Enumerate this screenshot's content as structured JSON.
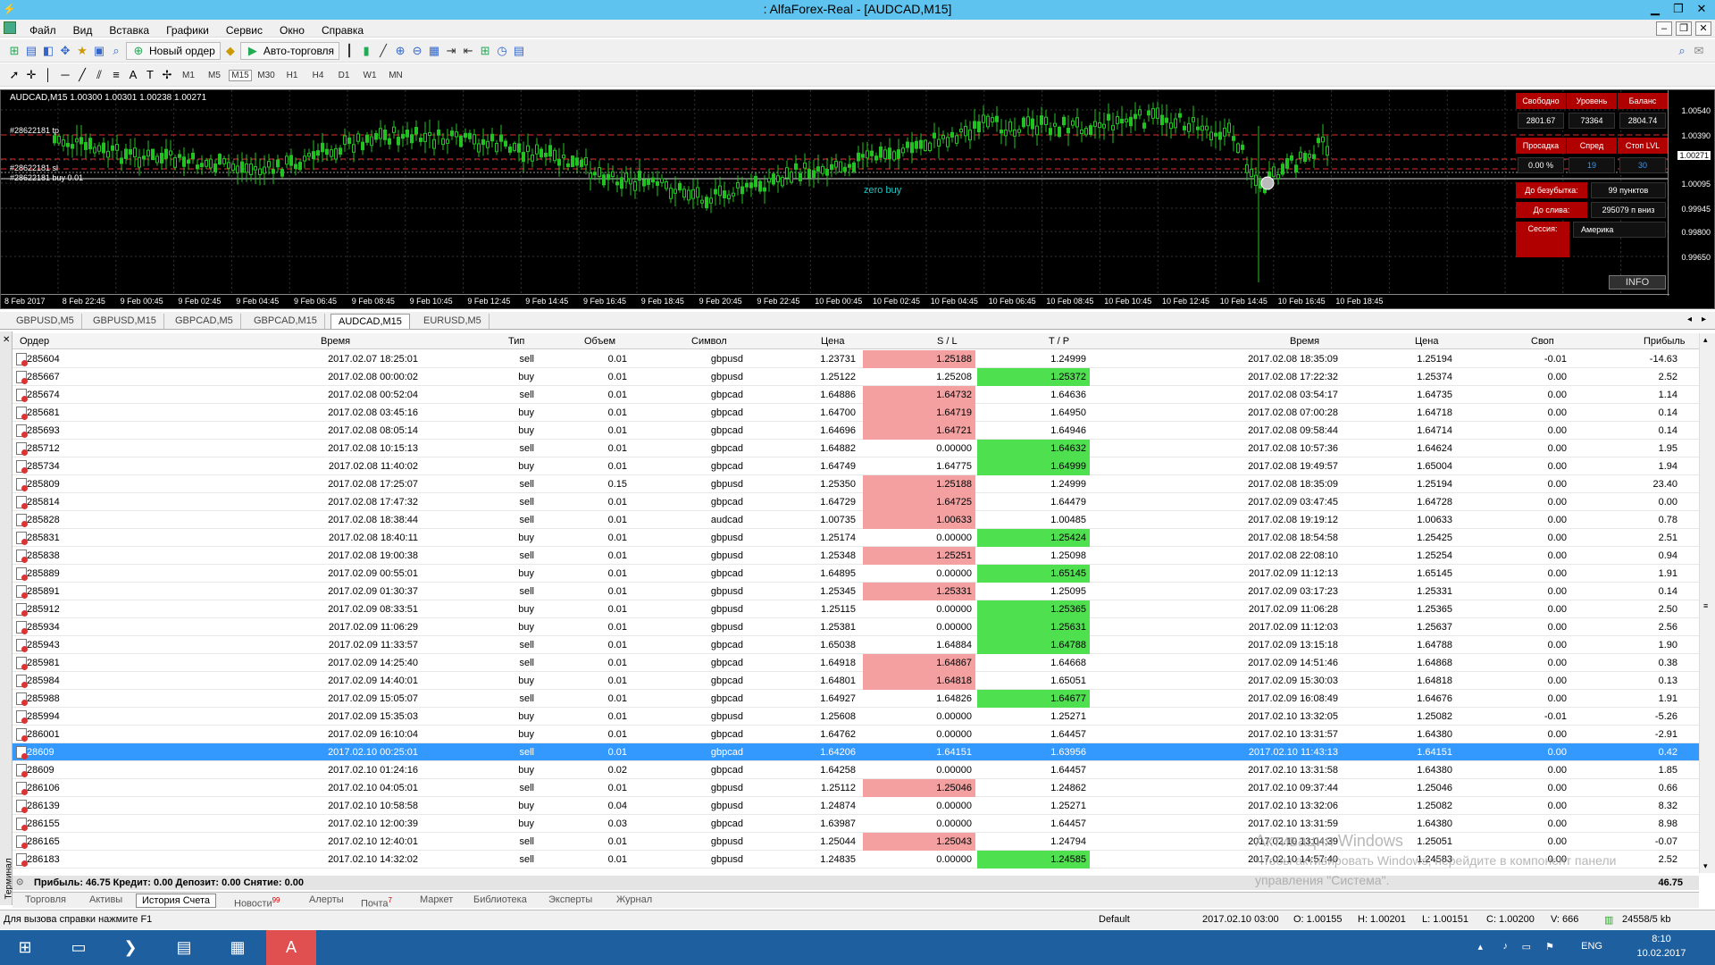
{
  "window": {
    "title": "AlfaForex-Real - [AUDCAD,M15]",
    "title_visible": ": AlfaForex-Real - [AUDCAD,M15]"
  },
  "menu": [
    "Файл",
    "Вид",
    "Вставка",
    "Графики",
    "Сервис",
    "Окно",
    "Справка"
  ],
  "toolbar": {
    "new_order": "Новый ордер",
    "auto_trading": "Авто-торговля"
  },
  "timeframes": [
    "M1",
    "M5",
    "M15",
    "M30",
    "H1",
    "H4",
    "D1",
    "W1",
    "MN"
  ],
  "active_timeframe": "M15",
  "chart": {
    "header": "AUDCAD,M15  1.00300 1.00301 1.00238 1.00271",
    "order_labels": [
      "#28622181 tp",
      "#28622181 sl",
      "#28622181 buy 0.01"
    ],
    "zero_buy_label": "zero buy",
    "price_ticks": [
      "1.00540",
      "1.00390",
      "1.00271",
      "1.00095",
      "0.99945",
      "0.99800",
      "0.99650"
    ],
    "current_price": "1.00271",
    "time_ticks": [
      "8 Feb 2017",
      "8 Feb 22:45",
      "9 Feb 00:45",
      "9 Feb 02:45",
      "9 Feb 04:45",
      "9 Feb 06:45",
      "9 Feb 08:45",
      "9 Feb 10:45",
      "9 Feb 12:45",
      "9 Feb 14:45",
      "9 Feb 16:45",
      "9 Feb 18:45",
      "9 Feb 20:45",
      "9 Feb 22:45",
      "10 Feb 00:45",
      "10 Feb 02:45",
      "10 Feb 04:45",
      "10 Feb 06:45",
      "10 Feb 08:45",
      "10 Feb 10:45",
      "10 Feb 12:45",
      "10 Feb 14:45",
      "10 Feb 16:45",
      "10 Feb 18:45"
    ],
    "panel": {
      "free_label": "Свободно",
      "level_label": "Уровень",
      "balance_label": "Баланс",
      "free": "2801.67",
      "level": "73364",
      "balance": "2804.74",
      "drawdown_label": "Просадка",
      "spread_label": "Спред",
      "stop_label": "Стоп LVL",
      "drawdown": "0.00 %",
      "spread": "19",
      "stop": "30",
      "breakeven_label": "До безубытка:",
      "breakeven": "99 пунктов",
      "margin_label": "До слива:",
      "margin": "295079 п вниз",
      "session_label": "Сессия:",
      "session": "Америка"
    },
    "info_button": "INFO"
  },
  "chart_tabs": [
    "GBPUSD,M5",
    "GBPUSD,M15",
    "GBPCAD,M5",
    "GBPCAD,M15",
    "AUDCAD,M15",
    "EURUSD,M5"
  ],
  "active_chart_tab": "AUDCAD,M15",
  "table": {
    "headers": [
      "Ордер",
      "Время",
      "Тип",
      "Объем",
      "Символ",
      "Цена",
      "S / L",
      "T / P",
      "Время",
      "Цена",
      "Своп",
      "Прибыль"
    ],
    "rows": [
      {
        "order": "285604",
        "t1": "2017.02.07 18:25:01",
        "type": "sell",
        "vol": "0.01",
        "sym": "gbpusd",
        "p1": "1.23731",
        "sl": "1.25188",
        "tp": "1.24999",
        "t2": "2017.02.08 18:35:09",
        "p2": "1.25194",
        "swap": "-0.01",
        "profit": "-14.63",
        "slh": true,
        "tph": false
      },
      {
        "order": "285667",
        "t1": "2017.02.08 00:00:02",
        "type": "buy",
        "vol": "0.01",
        "sym": "gbpusd",
        "p1": "1.25122",
        "sl": "1.25208",
        "tp": "1.25372",
        "t2": "2017.02.08 17:22:32",
        "p2": "1.25374",
        "swap": "0.00",
        "profit": "2.52",
        "slh": false,
        "tph": true
      },
      {
        "order": "285674",
        "t1": "2017.02.08 00:52:04",
        "type": "sell",
        "vol": "0.01",
        "sym": "gbpcad",
        "p1": "1.64886",
        "sl": "1.64732",
        "tp": "1.64636",
        "t2": "2017.02.08 03:54:17",
        "p2": "1.64735",
        "swap": "0.00",
        "profit": "1.14",
        "slh": true,
        "tph": false
      },
      {
        "order": "285681",
        "t1": "2017.02.08 03:45:16",
        "type": "buy",
        "vol": "0.01",
        "sym": "gbpcad",
        "p1": "1.64700",
        "sl": "1.64719",
        "tp": "1.64950",
        "t2": "2017.02.08 07:00:28",
        "p2": "1.64718",
        "swap": "0.00",
        "profit": "0.14",
        "slh": true,
        "tph": false
      },
      {
        "order": "285693",
        "t1": "2017.02.08 08:05:14",
        "type": "buy",
        "vol": "0.01",
        "sym": "gbpcad",
        "p1": "1.64696",
        "sl": "1.64721",
        "tp": "1.64946",
        "t2": "2017.02.08 09:58:44",
        "p2": "1.64714",
        "swap": "0.00",
        "profit": "0.14",
        "slh": true,
        "tph": false
      },
      {
        "order": "285712",
        "t1": "2017.02.08 10:15:13",
        "type": "sell",
        "vol": "0.01",
        "sym": "gbpcad",
        "p1": "1.64882",
        "sl": "0.00000",
        "tp": "1.64632",
        "t2": "2017.02.08 10:57:36",
        "p2": "1.64624",
        "swap": "0.00",
        "profit": "1.95",
        "slh": false,
        "tph": true
      },
      {
        "order": "285734",
        "t1": "2017.02.08 11:40:02",
        "type": "buy",
        "vol": "0.01",
        "sym": "gbpcad",
        "p1": "1.64749",
        "sl": "1.64775",
        "tp": "1.64999",
        "t2": "2017.02.08 19:49:57",
        "p2": "1.65004",
        "swap": "0.00",
        "profit": "1.94",
        "slh": false,
        "tph": true
      },
      {
        "order": "285809",
        "t1": "2017.02.08 17:25:07",
        "type": "sell",
        "vol": "0.15",
        "sym": "gbpusd",
        "p1": "1.25350",
        "sl": "1.25188",
        "tp": "1.24999",
        "t2": "2017.02.08 18:35:09",
        "p2": "1.25194",
        "swap": "0.00",
        "profit": "23.40",
        "slh": true,
        "tph": false
      },
      {
        "order": "285814",
        "t1": "2017.02.08 17:47:32",
        "type": "sell",
        "vol": "0.01",
        "sym": "gbpcad",
        "p1": "1.64729",
        "sl": "1.64725",
        "tp": "1.64479",
        "t2": "2017.02.09 03:47:45",
        "p2": "1.64728",
        "swap": "0.00",
        "profit": "0.00",
        "slh": true,
        "tph": false
      },
      {
        "order": "285828",
        "t1": "2017.02.08 18:38:44",
        "type": "sell",
        "vol": "0.01",
        "sym": "audcad",
        "p1": "1.00735",
        "sl": "1.00633",
        "tp": "1.00485",
        "t2": "2017.02.08 19:19:12",
        "p2": "1.00633",
        "swap": "0.00",
        "profit": "0.78",
        "slh": true,
        "tph": false
      },
      {
        "order": "285831",
        "t1": "2017.02.08 18:40:11",
        "type": "buy",
        "vol": "0.01",
        "sym": "gbpusd",
        "p1": "1.25174",
        "sl": "0.00000",
        "tp": "1.25424",
        "t2": "2017.02.08 18:54:58",
        "p2": "1.25425",
        "swap": "0.00",
        "profit": "2.51",
        "slh": false,
        "tph": true
      },
      {
        "order": "285838",
        "t1": "2017.02.08 19:00:38",
        "type": "sell",
        "vol": "0.01",
        "sym": "gbpusd",
        "p1": "1.25348",
        "sl": "1.25251",
        "tp": "1.25098",
        "t2": "2017.02.08 22:08:10",
        "p2": "1.25254",
        "swap": "0.00",
        "profit": "0.94",
        "slh": true,
        "tph": false
      },
      {
        "order": "285889",
        "t1": "2017.02.09 00:55:01",
        "type": "buy",
        "vol": "0.01",
        "sym": "gbpcad",
        "p1": "1.64895",
        "sl": "0.00000",
        "tp": "1.65145",
        "t2": "2017.02.09 11:12:13",
        "p2": "1.65145",
        "swap": "0.00",
        "profit": "1.91",
        "slh": false,
        "tph": true
      },
      {
        "order": "285891",
        "t1": "2017.02.09 01:30:37",
        "type": "sell",
        "vol": "0.01",
        "sym": "gbpusd",
        "p1": "1.25345",
        "sl": "1.25331",
        "tp": "1.25095",
        "t2": "2017.02.09 03:17:23",
        "p2": "1.25331",
        "swap": "0.00",
        "profit": "0.14",
        "slh": true,
        "tph": false
      },
      {
        "order": "285912",
        "t1": "2017.02.09 08:33:51",
        "type": "buy",
        "vol": "0.01",
        "sym": "gbpusd",
        "p1": "1.25115",
        "sl": "0.00000",
        "tp": "1.25365",
        "t2": "2017.02.09 11:06:28",
        "p2": "1.25365",
        "swap": "0.00",
        "profit": "2.50",
        "slh": false,
        "tph": true
      },
      {
        "order": "285934",
        "t1": "2017.02.09 11:06:29",
        "type": "buy",
        "vol": "0.01",
        "sym": "gbpusd",
        "p1": "1.25381",
        "sl": "0.00000",
        "tp": "1.25631",
        "t2": "2017.02.09 11:12:03",
        "p2": "1.25637",
        "swap": "0.00",
        "profit": "2.56",
        "slh": false,
        "tph": true
      },
      {
        "order": "285943",
        "t1": "2017.02.09 11:33:57",
        "type": "sell",
        "vol": "0.01",
        "sym": "gbpcad",
        "p1": "1.65038",
        "sl": "1.64884",
        "tp": "1.64788",
        "t2": "2017.02.09 13:15:18",
        "p2": "1.64788",
        "swap": "0.00",
        "profit": "1.90",
        "slh": false,
        "tph": true
      },
      {
        "order": "285981",
        "t1": "2017.02.09 14:25:40",
        "type": "sell",
        "vol": "0.01",
        "sym": "gbpcad",
        "p1": "1.64918",
        "sl": "1.64867",
        "tp": "1.64668",
        "t2": "2017.02.09 14:51:46",
        "p2": "1.64868",
        "swap": "0.00",
        "profit": "0.38",
        "slh": true,
        "tph": false
      },
      {
        "order": "285984",
        "t1": "2017.02.09 14:40:01",
        "type": "buy",
        "vol": "0.01",
        "sym": "gbpcad",
        "p1": "1.64801",
        "sl": "1.64818",
        "tp": "1.65051",
        "t2": "2017.02.09 15:30:03",
        "p2": "1.64818",
        "swap": "0.00",
        "profit": "0.13",
        "slh": true,
        "tph": false
      },
      {
        "order": "285988",
        "t1": "2017.02.09 15:05:07",
        "type": "sell",
        "vol": "0.01",
        "sym": "gbpcad",
        "p1": "1.64927",
        "sl": "1.64826",
        "tp": "1.64677",
        "t2": "2017.02.09 16:08:49",
        "p2": "1.64676",
        "swap": "0.00",
        "profit": "1.91",
        "slh": false,
        "tph": true
      },
      {
        "order": "285994",
        "t1": "2017.02.09 15:35:03",
        "type": "buy",
        "vol": "0.01",
        "sym": "gbpusd",
        "p1": "1.25608",
        "sl": "0.00000",
        "tp": "1.25271",
        "t2": "2017.02.10 13:32:05",
        "p2": "1.25082",
        "swap": "-0.01",
        "profit": "-5.26",
        "slh": false,
        "tph": false
      },
      {
        "order": "286001",
        "t1": "2017.02.09 16:10:04",
        "type": "buy",
        "vol": "0.01",
        "sym": "gbpcad",
        "p1": "1.64762",
        "sl": "0.00000",
        "tp": "1.64457",
        "t2": "2017.02.10 13:31:57",
        "p2": "1.64380",
        "swap": "0.00",
        "profit": "-2.91",
        "slh": false,
        "tph": false
      },
      {
        "order": "28609",
        "t1": "2017.02.10 00:25:01",
        "type": "sell",
        "vol": "0.01",
        "sym": "gbpcad",
        "p1": "1.64206",
        "sl": "1.64151",
        "tp": "1.63956",
        "t2": "2017.02.10 11:43:13",
        "p2": "1.64151",
        "swap": "0.00",
        "profit": "0.42",
        "slh": false,
        "tph": false,
        "selected": true
      },
      {
        "order": "28609",
        "t1": "2017.02.10 01:24:16",
        "type": "buy",
        "vol": "0.02",
        "sym": "gbpcad",
        "p1": "1.64258",
        "sl": "0.00000",
        "tp": "1.64457",
        "t2": "2017.02.10 13:31:58",
        "p2": "1.64380",
        "swap": "0.00",
        "profit": "1.85",
        "slh": false,
        "tph": false
      },
      {
        "order": "286106",
        "t1": "2017.02.10 04:05:01",
        "type": "sell",
        "vol": "0.01",
        "sym": "gbpusd",
        "p1": "1.25112",
        "sl": "1.25046",
        "tp": "1.24862",
        "t2": "2017.02.10 09:37:44",
        "p2": "1.25046",
        "swap": "0.00",
        "profit": "0.66",
        "slh": true,
        "tph": false
      },
      {
        "order": "286139",
        "t1": "2017.02.10 10:58:58",
        "type": "buy",
        "vol": "0.04",
        "sym": "gbpusd",
        "p1": "1.24874",
        "sl": "0.00000",
        "tp": "1.25271",
        "t2": "2017.02.10 13:32:06",
        "p2": "1.25082",
        "swap": "0.00",
        "profit": "8.32",
        "slh": false,
        "tph": false
      },
      {
        "order": "286155",
        "t1": "2017.02.10 12:00:39",
        "type": "buy",
        "vol": "0.03",
        "sym": "gbpcad",
        "p1": "1.63987",
        "sl": "0.00000",
        "tp": "1.64457",
        "t2": "2017.02.10 13:31:59",
        "p2": "1.64380",
        "swap": "0.00",
        "profit": "8.98",
        "slh": false,
        "tph": false
      },
      {
        "order": "286165",
        "t1": "2017.02.10 12:40:01",
        "type": "sell",
        "vol": "0.01",
        "sym": "gbpusd",
        "p1": "1.25044",
        "sl": "1.25043",
        "tp": "1.24794",
        "t2": "2017.02.10 13:04:39",
        "p2": "1.25051",
        "swap": "0.00",
        "profit": "-0.07",
        "slh": true,
        "tph": false
      },
      {
        "order": "286183",
        "t1": "2017.02.10 14:32:02",
        "type": "sell",
        "vol": "0.01",
        "sym": "gbpusd",
        "p1": "1.24835",
        "sl": "0.00000",
        "tp": "1.24585",
        "t2": "2017.02.10 14:57:40",
        "p2": "1.24583",
        "swap": "0.00",
        "profit": "2.52",
        "slh": false,
        "tph": true
      }
    ],
    "summary": "Прибыль: 46.75  Кредит: 0.00  Депозит: 0.00  Снятие: 0.00",
    "summary_total": "46.75"
  },
  "terminal_side_label": "Терминал",
  "bottom_tabs": [
    "Торговля",
    "Активы",
    "История Счета",
    "Новости",
    "Алерты",
    "Почта",
    "Маркет",
    "Библиотека",
    "Эксперты",
    "Журнал"
  ],
  "bottom_tabs_badges": {
    "news": "99",
    "mail": "7"
  },
  "active_bottom_tab": "История Счета",
  "status": {
    "help": "Для вызова справки нажмите F1",
    "profile": "Default",
    "datetime": "2017.02.10 03:00",
    "open": "O: 1.00155",
    "high": "H: 1.00201",
    "low": "L: 1.00151",
    "close": "C: 1.00200",
    "volume": "V: 666",
    "traffic": "24558/5 kb"
  },
  "watermark": [
    "Активация Windows",
    "Чтобы активировать Windows, перейдите в компонент панели",
    "управления \"Система\"."
  ],
  "taskbar": {
    "lang": "ENG",
    "time": "8:10",
    "date": "10.02.2017"
  }
}
